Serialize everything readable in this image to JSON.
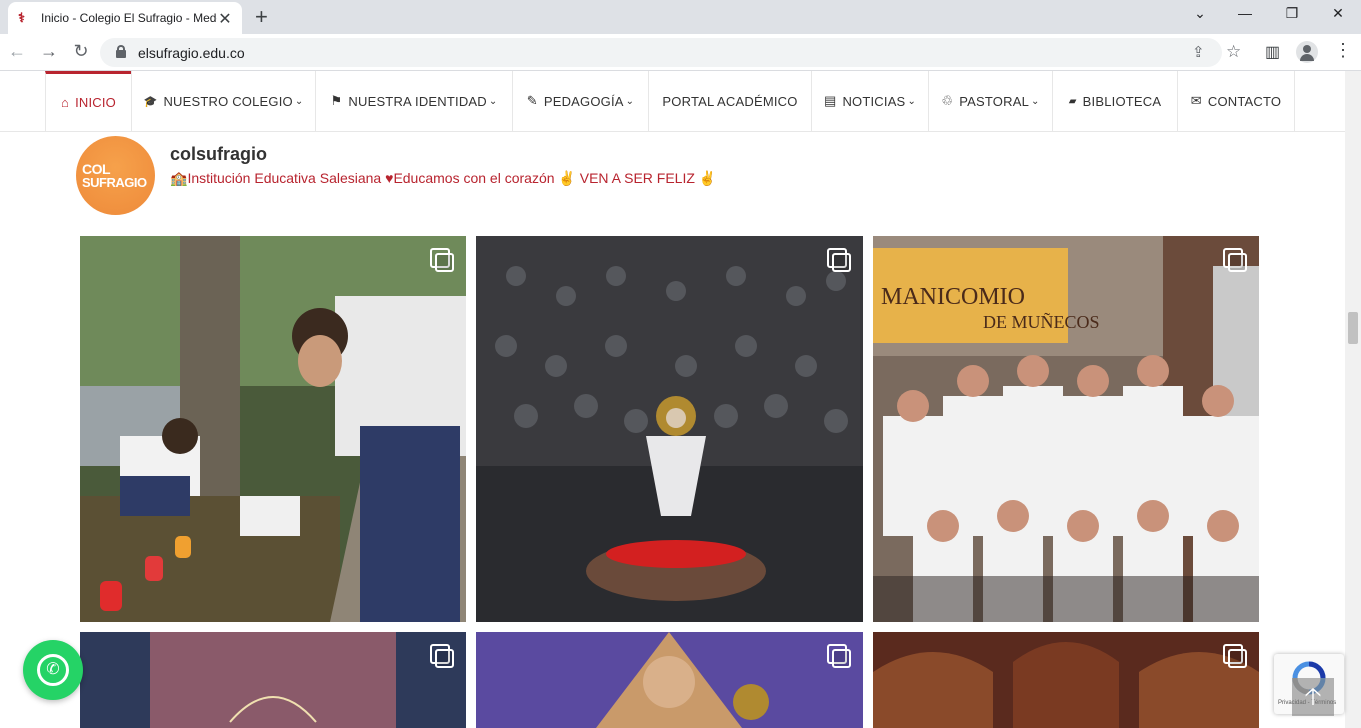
{
  "browser": {
    "tab_title": "Inicio - Colegio El Sufragio - Medellín",
    "url": "elsufragio.edu.co",
    "new_tab": "+",
    "back": "←",
    "forward": "→",
    "reload": "↻",
    "close_tab": "✕",
    "minimize": "—",
    "restore": "❐",
    "close": "✕",
    "share": "⇪",
    "bookmark": "☆",
    "sidepanel": "▥",
    "menu": "⋮",
    "chevron": "⌄"
  },
  "nav": {
    "items": [
      {
        "label": "INICIO",
        "icon": "home-icon",
        "glyph": "⌂",
        "caret": ""
      },
      {
        "label": "NUESTRO COLEGIO",
        "icon": "graduation-cap-icon",
        "glyph": "🎓",
        "caret": "⌄"
      },
      {
        "label": "NUESTRA IDENTIDAD",
        "icon": "flag-icon",
        "glyph": "⚑",
        "caret": "⌄"
      },
      {
        "label": "PEDAGOGÍA",
        "icon": "pencil-icon",
        "glyph": "✎",
        "caret": "⌄"
      },
      {
        "label": "PORTAL ACADÉMICO",
        "icon": "",
        "glyph": "",
        "caret": ""
      },
      {
        "label": "NOTICIAS",
        "icon": "newspaper-icon",
        "glyph": "▤",
        "caret": "⌄"
      },
      {
        "label": "PASTORAL",
        "icon": "hands-icon",
        "glyph": "♲",
        "caret": "⌄"
      },
      {
        "label": "BIBLIOTECA",
        "icon": "book-icon",
        "glyph": "▰",
        "caret": ""
      },
      {
        "label": "CONTACTO",
        "icon": "envelope-icon",
        "glyph": "✉",
        "caret": ""
      }
    ]
  },
  "instagram": {
    "avatar_line1": "COL",
    "avatar_line2": "SUFRAGIO",
    "username": "colsufragio",
    "bio_emoji1": "🏫",
    "bio_part1": "Institución Educativa Salesiana ",
    "bio_heart": "♥",
    "bio_part2": "Educamos con el corazón ",
    "bio_hand": "✌",
    "bio_part3": "  VEN A SER FELIZ ",
    "bio_hand2": "✌",
    "posts_sign_text": "MANICOMIO DE MUÑECOS"
  },
  "floating": {
    "whatsapp_icon": "whatsapp-icon",
    "to_top": "🡡",
    "recaptcha_text": "Privacidad - Términos"
  },
  "colors": {
    "brand": "#b8242f",
    "whatsapp": "#25d366"
  }
}
